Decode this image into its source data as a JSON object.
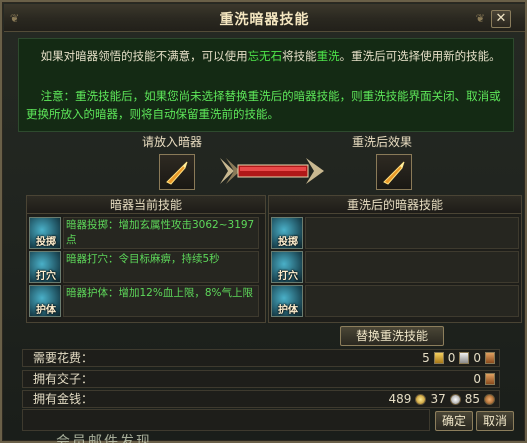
{
  "window": {
    "title": "重洗暗器技能",
    "close_label": "✕",
    "ornament_left": "❦",
    "ornament_right": "❦"
  },
  "notice": {
    "line1_pre": "如果对暗器领悟的技能不满意，可以使用",
    "line1_item": "忘无石",
    "line1_mid": "将技能",
    "line1_action": "重洗",
    "line1_post": "。重洗后可选择使用新的技能。",
    "line2": "注意：重洗技能后，如果您尚未选择替换重洗后的暗器技能，则重洗技能界面关闭、取消或更换所放入的暗器，则将自动保留重洗前的技能。"
  },
  "slots": {
    "input_label": "请放入暗器",
    "result_label": "重洗后效果"
  },
  "current_skills": {
    "header": "暗器当前技能",
    "items": [
      {
        "tag": "投掷",
        "text": "暗器投掷：增加玄属性攻击3062~3197点"
      },
      {
        "tag": "打穴",
        "text": "暗器打穴：令目标麻痹，持续5秒"
      },
      {
        "tag": "护体",
        "text": "暗器护体：增加12%血上限，8%气上限"
      }
    ]
  },
  "new_skills": {
    "header": "重洗后的暗器技能",
    "items": [
      {
        "tag": "投掷"
      },
      {
        "tag": "打穴"
      },
      {
        "tag": "护体"
      }
    ]
  },
  "replace_button": "替换重洗技能",
  "costs": {
    "cost_label": "需要花费：",
    "cost_values": [
      "5",
      "0",
      "0"
    ],
    "jiaozi_label": "拥有交子：",
    "jiaozi_value": "0",
    "money_label": "拥有金钱：",
    "money_values": [
      "489",
      "37",
      "85"
    ]
  },
  "buttons": {
    "confirm": "确定",
    "cancel": "取消"
  },
  "background_text": "会员邮件发现",
  "colors": {
    "accent_green": "#5ee85a",
    "frame_gold": "#8a7a58"
  }
}
